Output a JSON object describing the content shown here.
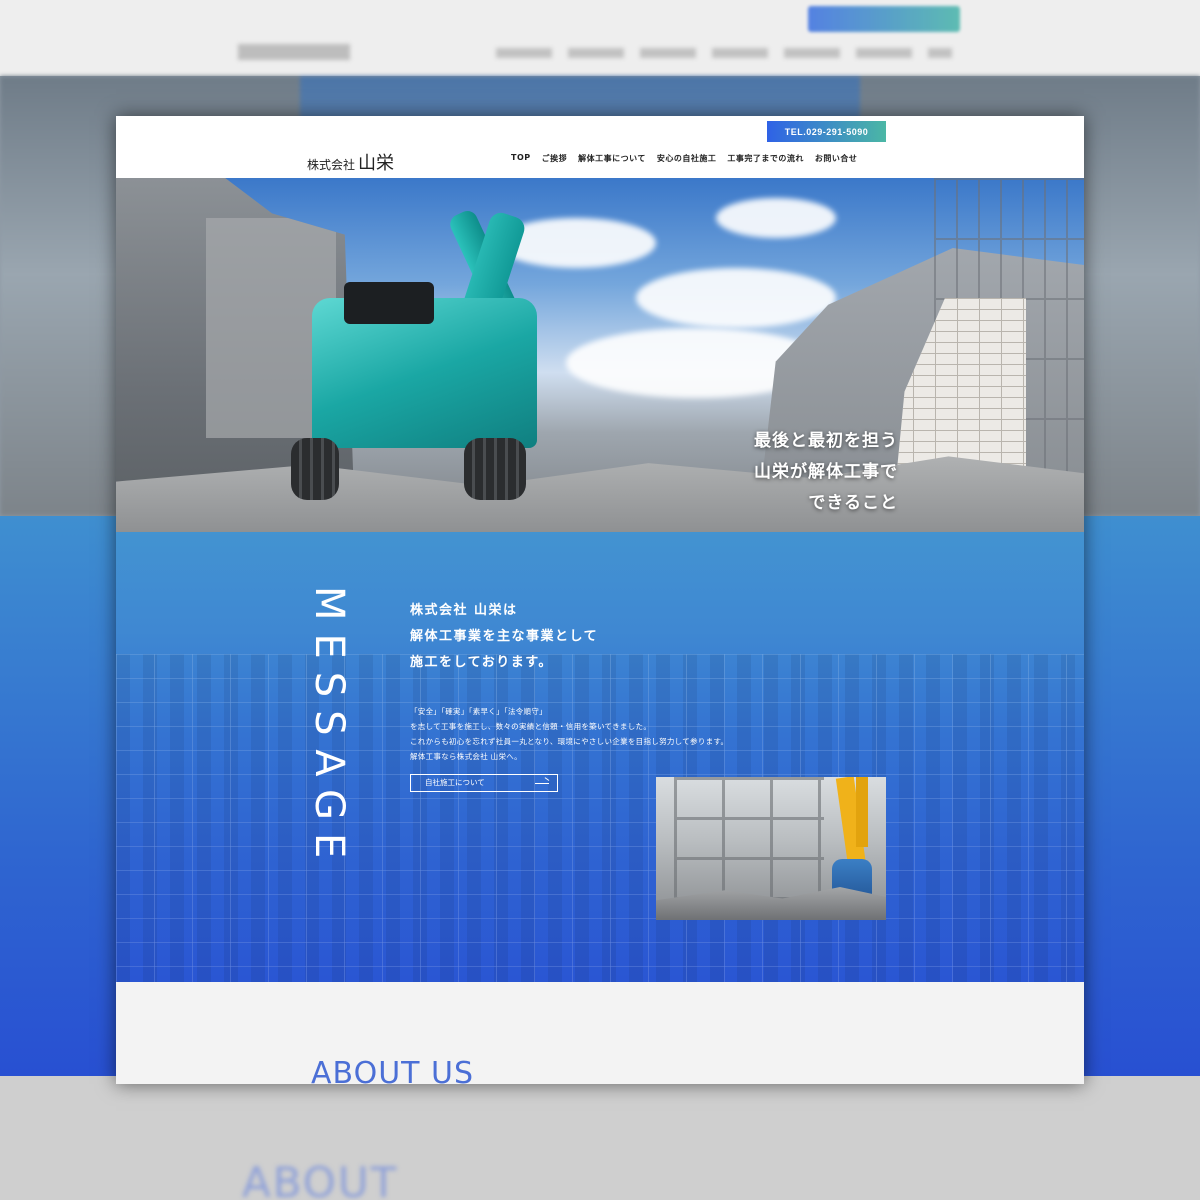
{
  "header": {
    "tel": "TEL.029-291-5090",
    "logo_small": "株式会社",
    "logo_big": "山栄",
    "nav": [
      "TOP",
      "ご挨拶",
      "解体工事について",
      "安心の自社施工",
      "工事完了までの流れ",
      "お問い合せ"
    ]
  },
  "hero": {
    "copy": [
      "最後と最初を担う",
      "山栄が解体工事で",
      "できること"
    ]
  },
  "message": {
    "vertical_title": "MESSAGE",
    "lead": [
      "株式会社 山栄は",
      "解体工事業を主な事業として",
      "施工をしております。"
    ],
    "body": [
      "「安全」「確実」「素早く」「法令順守」",
      "を志して工事を施工し、数々の実績と信頼・信用を築いてきました。",
      "これからも初心を忘れず社員一丸となり、環境にやさしい企業を目指し努力して参ります。",
      "解体工事なら株式会社 山栄へ。"
    ],
    "button": "自社施工について"
  },
  "about": {
    "title": "ABOUT US"
  },
  "colors": {
    "tel_gradient_start": "#2f62e6",
    "tel_gradient_end": "#4bb7a5",
    "message_blue": "#3473d2",
    "about_title": "#4b6fd6",
    "about_bg": "#f3f3f3"
  },
  "icons": {
    "button_arrow": "arrow-right-icon"
  }
}
